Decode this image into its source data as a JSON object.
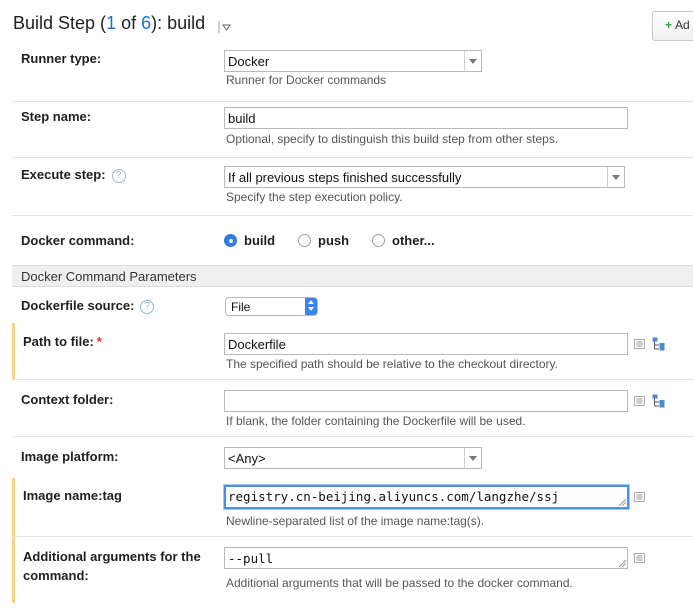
{
  "header": {
    "title_prefix": "Build Step (",
    "step_current": "1",
    "title_of": " of ",
    "step_total": "6",
    "title_suffix": "): build",
    "add_button_label": "Ad"
  },
  "fields": {
    "runner_type": {
      "label": "Runner type:",
      "value": "Docker",
      "hint": "Runner for Docker commands"
    },
    "step_name": {
      "label": "Step name:",
      "value": "build",
      "hint": "Optional, specify to distinguish this build step from other steps."
    },
    "execute_step": {
      "label": "Execute step:",
      "value": "If all previous steps finished successfully",
      "hint": "Specify the step execution policy.",
      "help": "?"
    },
    "docker_command": {
      "label": "Docker command:",
      "options": [
        "build",
        "push",
        "other..."
      ],
      "selected": "build"
    },
    "section_title": "Docker Command Parameters",
    "dockerfile_source": {
      "label": "Dockerfile source:",
      "value": "File",
      "help": "?"
    },
    "path_to_file": {
      "label": "Path to file:",
      "required": "*",
      "value": "Dockerfile",
      "hint": "The specified path should be relative to the checkout directory."
    },
    "context_folder": {
      "label": "Context folder:",
      "value": "",
      "hint": "If blank, the folder containing the Dockerfile will be used."
    },
    "image_platform": {
      "label": "Image platform:",
      "value": "<Any>"
    },
    "image_name_tag": {
      "label": "Image name:tag",
      "value": "registry.cn-beijing.aliyuncs.com/langzhe/ssj",
      "hint": "Newline-separated list of the image name:tag(s)."
    },
    "additional_args": {
      "label_line1": "Additional arguments for the",
      "label_line2": "command:",
      "value": "--pull",
      "hint": "Additional arguments that will be passed to the docker command."
    }
  },
  "colors": {
    "accent": "#2f7be0",
    "required_marker": "#f2d58a",
    "link_number": "#1a6fd8"
  },
  "icons": {
    "editor": "text-editor-icon",
    "tree": "tree-picker-icon",
    "caret": "caret-down-icon",
    "plus": "plus-icon"
  }
}
